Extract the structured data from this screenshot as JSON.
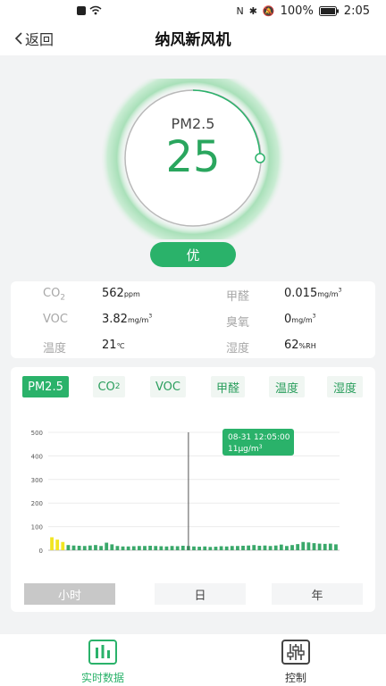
{
  "status_bar": {
    "battery": "100%",
    "time": "2:05"
  },
  "header": {
    "back_label": "返回",
    "title": "纳风新风机"
  },
  "gauge": {
    "label": "PM2.5",
    "value": "25",
    "quality": "优"
  },
  "metrics": [
    {
      "label": "CO",
      "label_sub": "2",
      "value": "562",
      "unit": "ppm",
      "unit_sup": ""
    },
    {
      "label": "甲醛",
      "label_sub": "",
      "value": "0.015",
      "unit": "mg/m",
      "unit_sup": "3"
    },
    {
      "label": "VOC",
      "label_sub": "",
      "value": "3.82",
      "unit": "mg/m",
      "unit_sup": "3"
    },
    {
      "label": "臭氧",
      "label_sub": "",
      "value": "0",
      "unit": "mg/m",
      "unit_sup": "3"
    },
    {
      "label": "温度",
      "label_sub": "",
      "value": "21",
      "unit": "℃",
      "unit_sup": ""
    },
    {
      "label": "湿度",
      "label_sub": "",
      "value": "62",
      "unit": "%RH",
      "unit_sup": ""
    }
  ],
  "tabs": [
    {
      "label": "PM2.5",
      "sub": ""
    },
    {
      "label": "CO",
      "sub": "2"
    },
    {
      "label": "VOC",
      "sub": ""
    },
    {
      "label": "甲醛",
      "sub": ""
    },
    {
      "label": "温度",
      "sub": ""
    },
    {
      "label": "湿度",
      "sub": ""
    }
  ],
  "ranges": [
    "小时",
    "日",
    "年"
  ],
  "nav": {
    "realtime": "实时数据",
    "control": "控制"
  },
  "colors": {
    "accent": "#2ab26a",
    "yellow_bar": "#f1e521",
    "grey_bg": "#f2f3f4"
  },
  "chart_data": {
    "type": "bar",
    "ylim": [
      0,
      500
    ],
    "yticks": [
      0,
      100,
      200,
      300,
      400,
      500
    ],
    "values": [
      55,
      45,
      35,
      22,
      20,
      19,
      18,
      20,
      22,
      18,
      32,
      25,
      18,
      16,
      16,
      17,
      18,
      18,
      19,
      18,
      17,
      16,
      18,
      17,
      19,
      18,
      16,
      15,
      16,
      14,
      15,
      17,
      16,
      18,
      18,
      19,
      20,
      22,
      19,
      20,
      18,
      20,
      24,
      18,
      22,
      26,
      35,
      33,
      30,
      28,
      27,
      28,
      25
    ],
    "highlight_count": 3,
    "selected_index": 25,
    "tooltip": {
      "time": "08-31 12:05:00",
      "value": "11",
      "unit": "μg/m",
      "unit_sup": "3"
    }
  }
}
